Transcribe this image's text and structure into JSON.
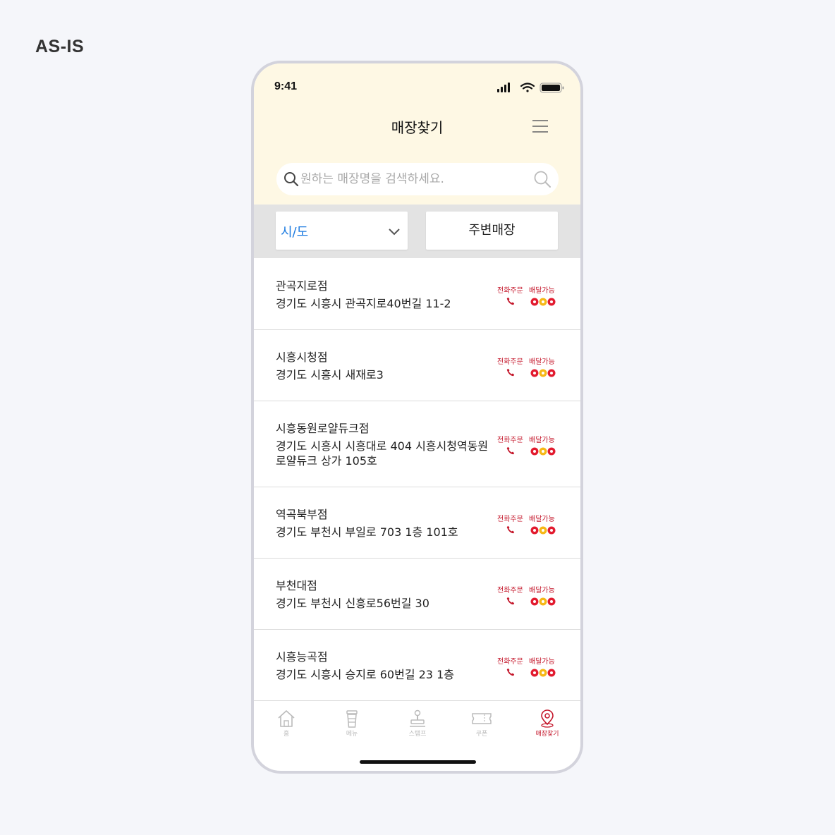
{
  "label": "AS-IS",
  "status_bar": {
    "time": "9:41"
  },
  "header": {
    "title": "매장찾기"
  },
  "search": {
    "placeholder": "원하는 매장명을 검색하세요."
  },
  "filters": {
    "region": "시/도",
    "nearby": "주변매장"
  },
  "badges": {
    "phone_order": "전화주문",
    "delivery": "배달가능"
  },
  "accent_color": "#c4162a",
  "stores": [
    {
      "name": "관곡지로점",
      "address": "경기도 시흥시 관곡지로40번길 11-2"
    },
    {
      "name": "시흥시청점",
      "address": "경기도 시흥시 새재로3"
    },
    {
      "name": "시흥동원로얄듀크점",
      "address": "경기도 시흥시 시흥대로 404 시흥시청역동원로얄듀크 상가 105호"
    },
    {
      "name": "역곡북부점",
      "address": "경기도 부천시 부일로 703 1층 101호"
    },
    {
      "name": "부천대점",
      "address": "경기도 부천시 신흥로56번길 30"
    },
    {
      "name": "시흥능곡점",
      "address": "경기도 시흥시 승지로 60번길 23 1층"
    }
  ],
  "tabs": [
    {
      "label": "홈",
      "icon": "home-icon"
    },
    {
      "label": "메뉴",
      "icon": "cup-icon"
    },
    {
      "label": "스탬프",
      "icon": "stamp-icon"
    },
    {
      "label": "쿠폰",
      "icon": "coupon-icon"
    },
    {
      "label": "매장찾기",
      "icon": "location-pin-icon",
      "active": true
    }
  ]
}
